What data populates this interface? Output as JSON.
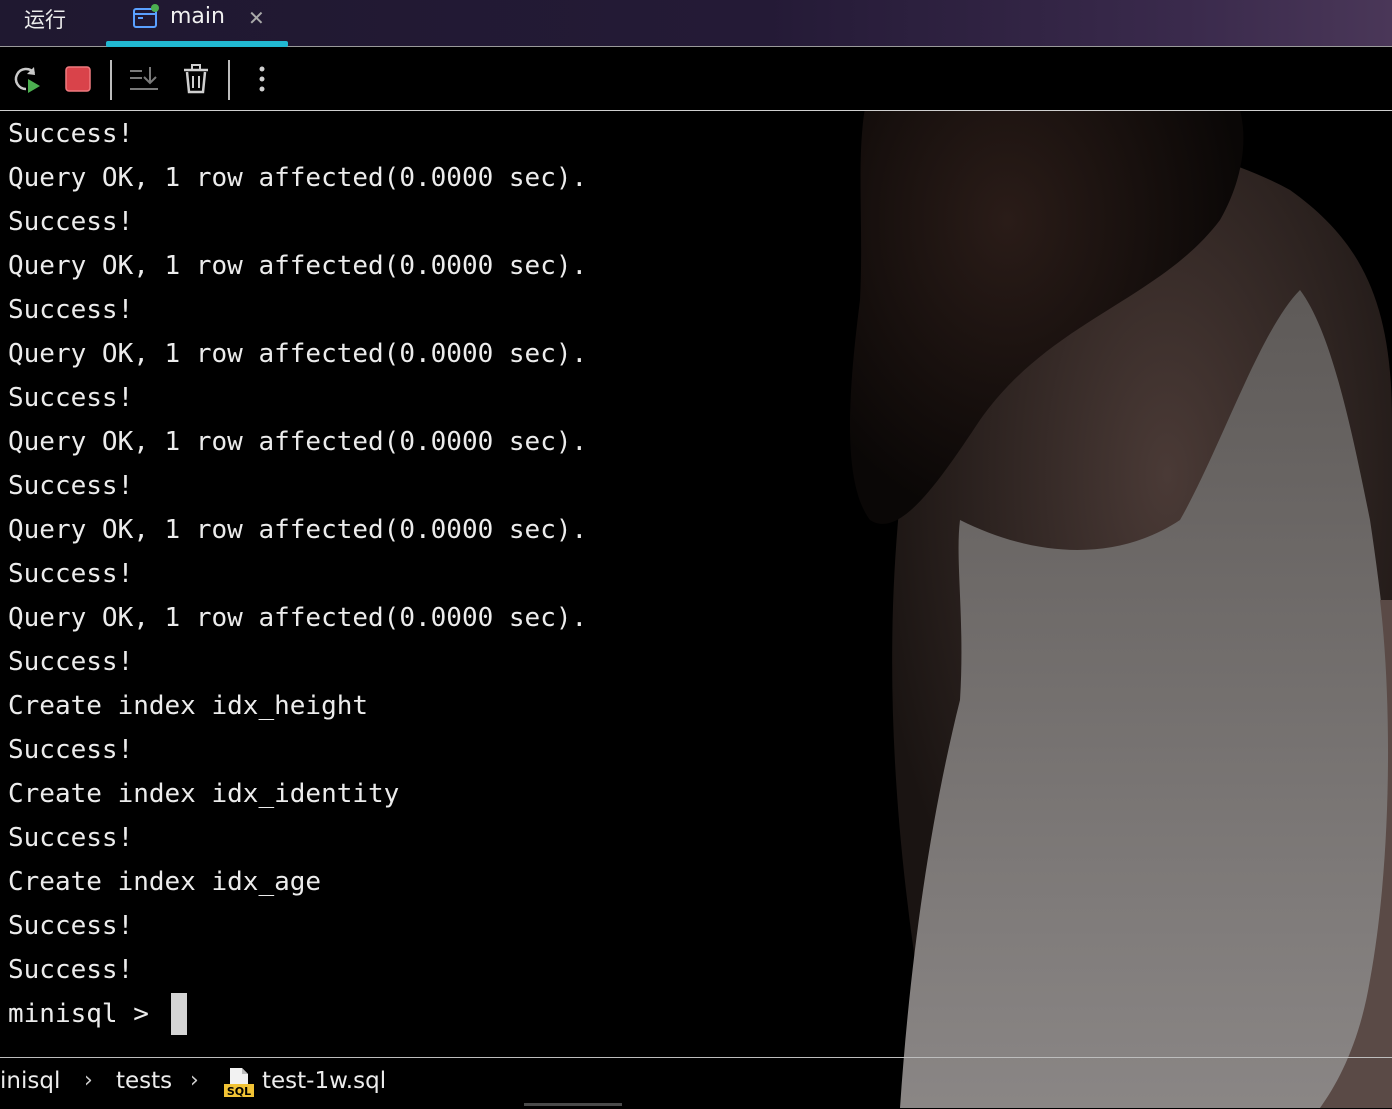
{
  "tabs": {
    "run_label": "运行",
    "active_label": "main",
    "close_icon": "close-icon",
    "accent_color": "#21b8d2"
  },
  "toolbar": {
    "icons": [
      "rerun-icon",
      "stop-icon",
      "scroll-to-end-icon",
      "trash-icon",
      "more-options-icon"
    ],
    "stop_color": "#d9434a"
  },
  "console": {
    "lines": [
      "Success!",
      "Query OK, 1 row affected(0.0000 sec).",
      "Success!",
      "Query OK, 1 row affected(0.0000 sec).",
      "Success!",
      "Query OK, 1 row affected(0.0000 sec).",
      "Success!",
      "Query OK, 1 row affected(0.0000 sec).",
      "Success!",
      "Query OK, 1 row affected(0.0000 sec).",
      "Success!",
      "Query OK, 1 row affected(0.0000 sec).",
      "Success!",
      "Create index idx_height",
      "Success!",
      "Create index idx_identity",
      "Success!",
      "Create index idx_age",
      "Success!",
      "Success!"
    ],
    "prompt": "minisql > "
  },
  "breadcrumb": {
    "items": [
      "inisql",
      "tests",
      "test-1w.sql"
    ],
    "file_icon": "sql-file-icon",
    "file_icon_text": "SQL"
  }
}
